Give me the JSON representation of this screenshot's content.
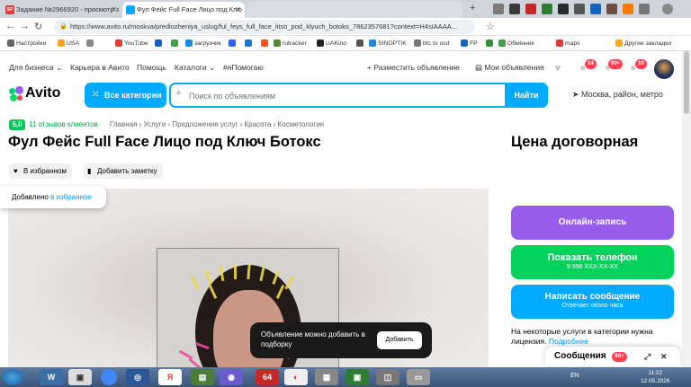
{
  "browser": {
    "tabs": [
      {
        "label": "Задание №2966920 - просмотр з",
        "icon_text": "SP",
        "color": "#e53935"
      },
      {
        "label": "Фул Фейс Full Face Лицо под Клю",
        "icon_text": "",
        "color": "#00aaff"
      }
    ],
    "url": "https://www.avito.ru/moskva/predlozheniya_uslug/ful_feys_full_face_litso_pod_klyuch_botoks_7862357681?context=H4sIAAAA...",
    "bookmarks": [
      "Настройки",
      "USA",
      "",
      "YouTube",
      "",
      "",
      "загрузчик",
      "",
      "",
      "",
      "rutracker",
      "UAKino",
      "",
      "SINOPTIK",
      "btc to usd",
      "FP",
      "",
      "Обмінник",
      "maps",
      "Другие закладки"
    ]
  },
  "nav": {
    "for_business": "Для бизнеса",
    "career": "Карьера в Авито",
    "help": "Помощь",
    "catalogs": "Каталоги",
    "ipomogayu": "#яПомогаю",
    "post_ad": "Разместить объявление",
    "my_ads": "Мои объявления",
    "badge_notifications": "14",
    "badge_messages": "99+",
    "badge_cart": "10"
  },
  "header": {
    "logo": "Avito",
    "categories_button": "Все категории",
    "search_placeholder": "Поиск по объявлениям",
    "search_button": "Найти",
    "location": "Москва, район, метро"
  },
  "listing": {
    "rating": "5,0",
    "reviews": "11 отзывов клиентов",
    "breadcrumbs": "Главная  ›  Услуги  ›  Предложение услуг  ›  Красота  ›  Косметология",
    "title": "Фул Фейс Full Face Лицо под Ключ Ботокс",
    "favorite_chip": "В избранном",
    "note_chip": "Добавить заметку",
    "fav_toast_prefix": "Добавлено ",
    "fav_toast_link": "в избранное",
    "collection_toast": "Объявление можно добавить в подборку",
    "collection_button": "Добавить"
  },
  "sidebar": {
    "price": "Цена договорная",
    "book_button": "Онлайн-запись",
    "phone_button": "Показать телефон",
    "phone_masked": "8 996 XXX-XX-XX",
    "message_button": "Написать сообщение",
    "message_sub": "Отвечает около часа",
    "notice": "На некоторые услуги в категории нужна лицензия.",
    "notice_link": "Подробнее",
    "messages_panel": "Сообщения",
    "messages_badge": "99+"
  },
  "taskbar": {
    "lang": "EN",
    "time": "11:22",
    "date": "12.05.2026",
    "badge_64": "64"
  },
  "colors": {
    "avito_blue": "#00aaff",
    "purple": "#965eeb",
    "green": "#02d15c",
    "blue_btn": "#00aaff"
  }
}
